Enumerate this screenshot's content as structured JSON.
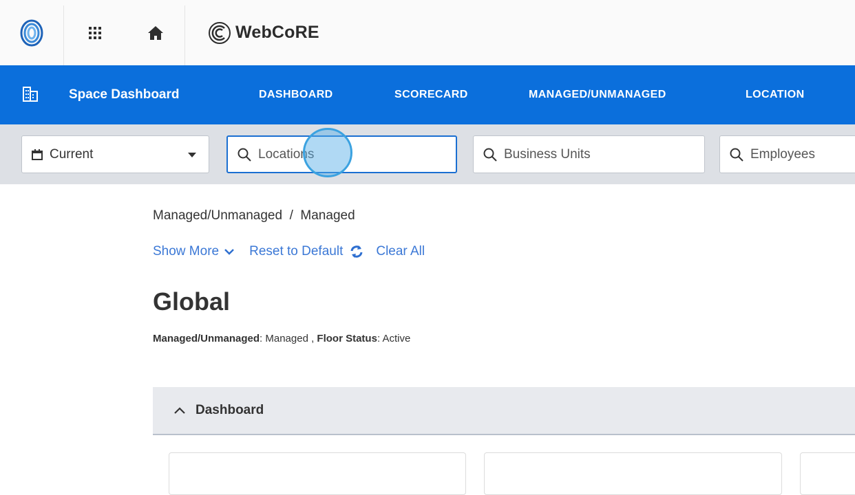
{
  "app": {
    "brand_name": "WebCoRE"
  },
  "nav": {
    "title": "Space Dashboard",
    "links": [
      "DASHBOARD",
      "SCORECARD",
      "MANAGED/UNMANAGED",
      "LOCATION"
    ],
    "color": "#0b6fdc"
  },
  "filters": {
    "period_value": "Current",
    "locations_placeholder": "Locations",
    "business_units_placeholder": "Business Units",
    "employees_placeholder": "Employees"
  },
  "content": {
    "breadcrumb": "Managed/Unmanaged  /  Managed",
    "show_more": "Show More",
    "reset": "Reset to Default",
    "clear_all": "Clear All",
    "title": "Global",
    "filter_label_1": "Managed/Unmanaged",
    "filter_value_1": ": Managed ,",
    "filter_label_2": "Floor Status",
    "filter_value_2": ": Active",
    "panel_title": "Dashboard"
  },
  "icons": {
    "logo": "swirl-logo-icon",
    "apps": "apps-grid-icon",
    "home": "home-icon",
    "brand": "webcore-logo-icon",
    "nav": "building-icon",
    "calendar": "calendar-icon",
    "search": "search-icon",
    "chevron_down": "chevron-down-icon",
    "refresh": "refresh-icon",
    "chevron_up": "chevron-up-icon"
  }
}
